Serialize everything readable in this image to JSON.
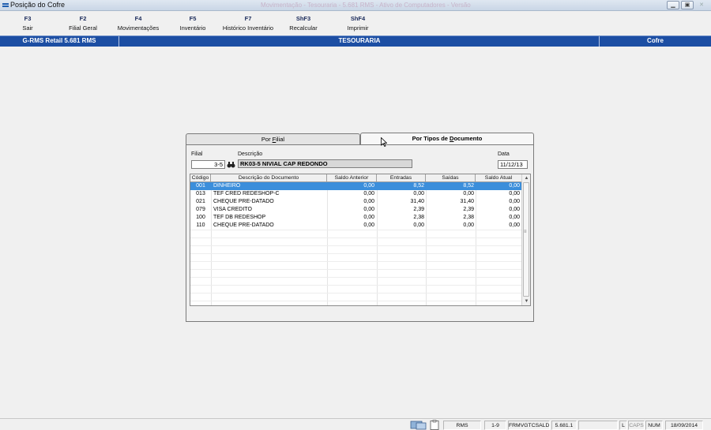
{
  "window": {
    "title": "Posição do Cofre",
    "ghost_text": "Movimentação - Tesouraria - 5.681 RMS - Ativo de Computadores - Versão"
  },
  "fkeys": [
    {
      "key": "F3",
      "label": "Sair"
    },
    {
      "key": "F2",
      "label": "Filial Geral"
    },
    {
      "key": "F4",
      "label": "Movimentações"
    },
    {
      "key": "F5",
      "label": "Inventário"
    },
    {
      "key": "F7",
      "label": "Histórico Inventário"
    },
    {
      "key": "ShF3",
      "label": "Recalcular"
    },
    {
      "key": "ShF4",
      "label": "Imprimir"
    }
  ],
  "header": {
    "left": "G-RMS Retail 5.681 RMS",
    "center": "TESOURARIA",
    "right": "Cofre"
  },
  "tabs": {
    "filial_prefix": "Por ",
    "filial_accel": "F",
    "filial_suffix": "ilial",
    "doc_prefix": "Por Tipos de ",
    "doc_accel": "D",
    "doc_suffix": "ocumento"
  },
  "form": {
    "filial_label": "Filial",
    "filial_value": "3-5",
    "descricao_label": "Descrição",
    "descricao_value": "RK03-5 NIVIAL CAP REDONDO",
    "data_label": "Data",
    "data_value": "11/12/13"
  },
  "grid": {
    "columns": [
      "Código",
      "Descrição do Documento",
      "Saldo Anterior",
      "Entradas",
      "Saídas",
      "Saldo Atual"
    ],
    "rows": [
      {
        "codigo": "001",
        "descricao": "DINHEIRO",
        "saldo_anterior": "0,00",
        "entradas": "8,52",
        "saidas": "8,52",
        "saldo_atual": "0,00"
      },
      {
        "codigo": "013",
        "descricao": "TEF CRED REDESHOP-C",
        "saldo_anterior": "0,00",
        "entradas": "0,00",
        "saidas": "0,00",
        "saldo_atual": "0,00"
      },
      {
        "codigo": "021",
        "descricao": "CHEQUE PRE-DATADO",
        "saldo_anterior": "0,00",
        "entradas": "31,40",
        "saidas": "31,40",
        "saldo_atual": "0,00"
      },
      {
        "codigo": "079",
        "descricao": "VISA CREDITO",
        "saldo_anterior": "0,00",
        "entradas": "2,39",
        "saidas": "2,39",
        "saldo_atual": "0,00"
      },
      {
        "codigo": "100",
        "descricao": "TEF DB REDESHOP",
        "saldo_anterior": "0,00",
        "entradas": "2,38",
        "saidas": "2,38",
        "saldo_atual": "0,00"
      },
      {
        "codigo": "110",
        "descricao": "CHEQUE PRE-DATADO",
        "saldo_anterior": "0,00",
        "entradas": "0,00",
        "saidas": "0,00",
        "saldo_atual": "0,00"
      }
    ]
  },
  "status": {
    "system": "RMS",
    "range": "1-9",
    "program": "FRMVGTCSALD",
    "version": "5.681.1",
    "l": "L",
    "caps": "CAPS",
    "num": "NUM",
    "date": "18/09/2014"
  },
  "colors": {
    "header_blue": "#1c4ea3",
    "selection_blue": "#3b8edb"
  }
}
